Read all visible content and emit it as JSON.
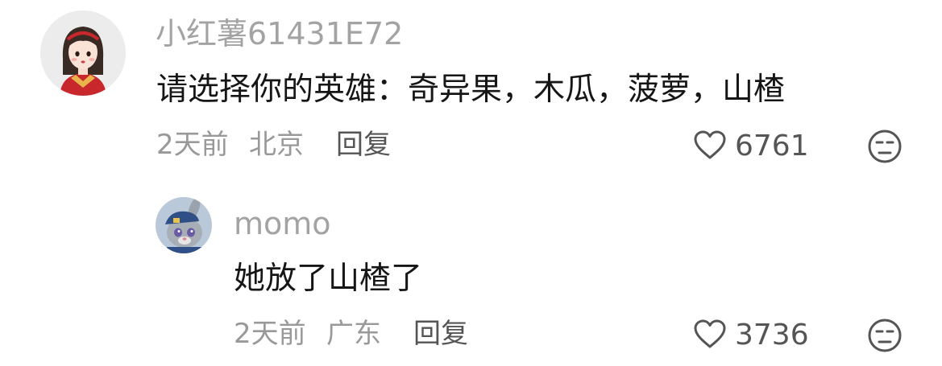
{
  "comments": [
    {
      "username": "小红薯61431E72",
      "content": "请选择你的英雄：奇异果，木瓜，菠萝，山楂",
      "time": "2天前",
      "location": "北京",
      "reply_label": "回复",
      "likes": "6761",
      "avatar": "girl-avatar"
    }
  ],
  "replies": [
    {
      "username": "momo",
      "content": "她放了山楂了",
      "time": "2天前",
      "location": "广东",
      "reply_label": "回复",
      "likes": "3736",
      "avatar": "bunny-officer-avatar"
    }
  ],
  "icons": {
    "like": "heart-outline-icon",
    "dislike": "unamused-face-icon"
  },
  "colors": {
    "username": "#a3a3a3",
    "content": "#161616",
    "meta": "#999999",
    "action": "#555555"
  }
}
